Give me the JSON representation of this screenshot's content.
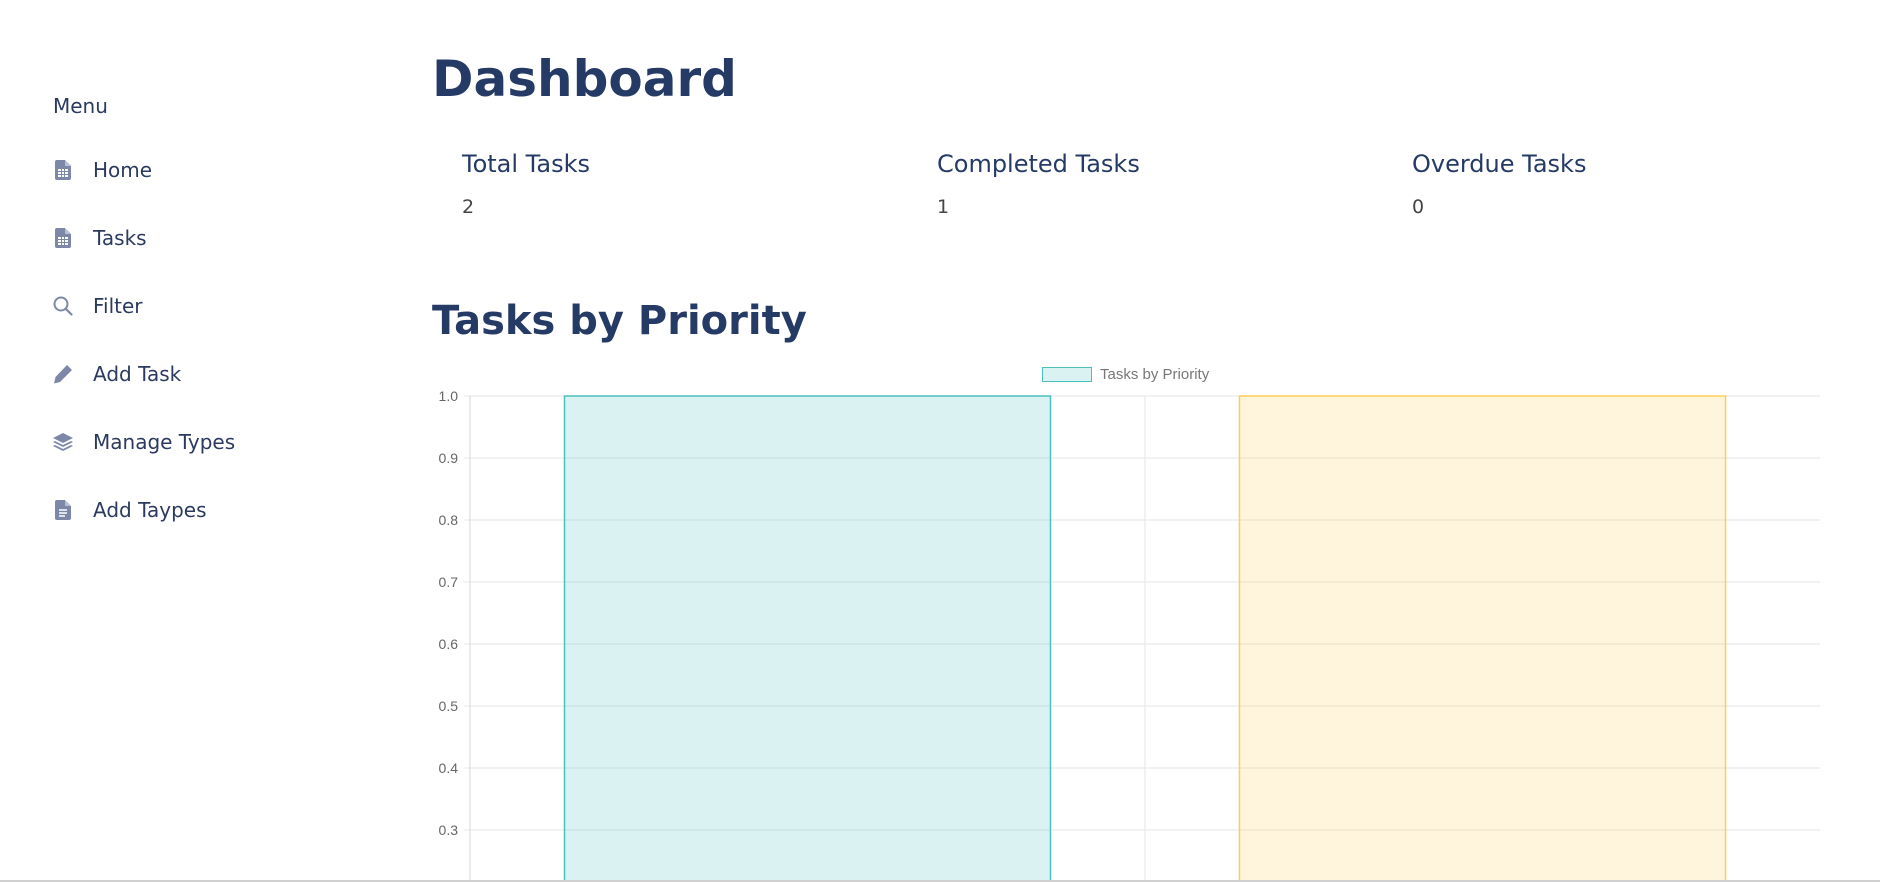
{
  "sidebar": {
    "menu_label": "Menu",
    "items": [
      {
        "label": "Home",
        "icon": "table-file-icon"
      },
      {
        "label": "Tasks",
        "icon": "table-file-icon"
      },
      {
        "label": "Filter",
        "icon": "search-icon"
      },
      {
        "label": "Add Task",
        "icon": "pencil-icon"
      },
      {
        "label": "Manage Types",
        "icon": "layers-icon"
      },
      {
        "label": "Add Taypes",
        "icon": "document-icon"
      }
    ]
  },
  "main": {
    "title": "Dashboard",
    "stats": [
      {
        "title": "Total Tasks",
        "value": "2"
      },
      {
        "title": "Completed Tasks",
        "value": "1"
      },
      {
        "title": "Overdue Tasks",
        "value": "0"
      }
    ],
    "chart_section_title": "Tasks by Priority"
  },
  "colors": {
    "heading": "#263a66",
    "nav_icon": "#7d88a8",
    "bar_teal_border": "#4bc0c0",
    "bar_teal_fill": "rgba(75,192,192,0.2)",
    "bar_yellow_border": "#ffcd56",
    "bar_yellow_fill": "rgba(255,205,86,0.2)",
    "grid": "#e5e5e5"
  },
  "chart_data": {
    "type": "bar",
    "legend": [
      "Tasks by Priority"
    ],
    "legend_position": "top-center",
    "categories": [
      "",
      ""
    ],
    "series": [
      {
        "name": "Tasks by Priority",
        "values": [
          1,
          1
        ]
      }
    ],
    "bar_colors": [
      "teal",
      "yellow"
    ],
    "yticks": [
      "1.0",
      "0.9",
      "0.8",
      "0.7",
      "0.6",
      "0.5",
      "0.4",
      "0.3"
    ],
    "ylim_visible": [
      0.2,
      1.0
    ],
    "grid": true
  }
}
